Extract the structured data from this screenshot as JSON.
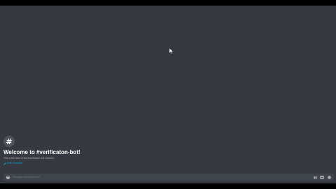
{
  "welcome": {
    "avatar_glyph": "#",
    "title": "Welcome to #verificaton-bot!",
    "subtitle": "This is the start of the #verificaton-bot channel.",
    "edit_label": "Edit Channel"
  },
  "composer": {
    "placeholder": "Message #verificaton-bot",
    "attach_glyph": "+"
  },
  "icons": {
    "attach": "plus-circle-icon",
    "gift": "gift-icon",
    "gif": "gif-icon",
    "emoji": "emoji-icon",
    "edit": "pencil-icon"
  },
  "colors": {
    "background": "#36393f",
    "composer": "#40444b",
    "link": "#00aff4",
    "title": "#ffffff",
    "muted": "#b9bbbe"
  }
}
